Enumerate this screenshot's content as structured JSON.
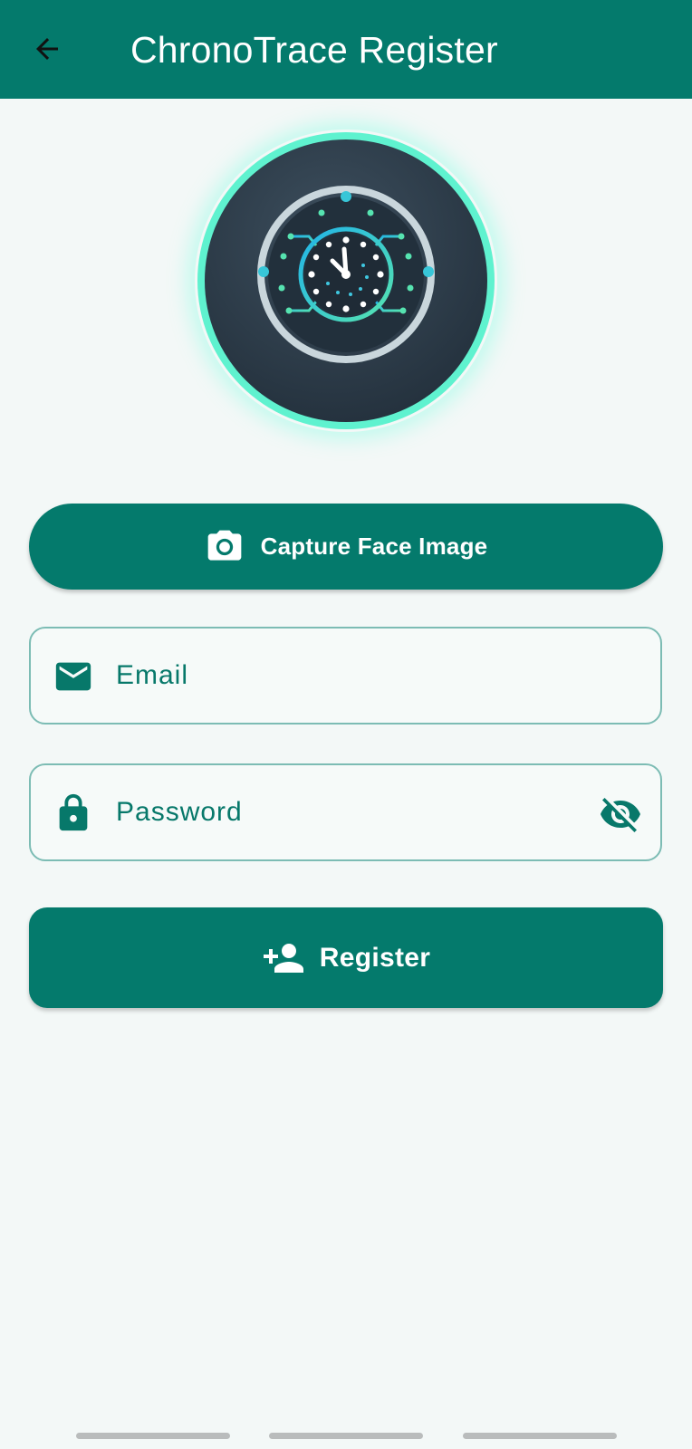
{
  "appbar": {
    "title": "ChronoTrace Register",
    "back_icon": "arrow-back-icon",
    "background": "#047a6c"
  },
  "logo": {
    "icon": "circuit-clock-logo",
    "ring_color": "#5ff2cf"
  },
  "capture_button": {
    "label": "Capture Face Image",
    "icon": "camera-icon"
  },
  "email_field": {
    "placeholder": "Email",
    "value": "",
    "icon": "mail-icon"
  },
  "password_field": {
    "placeholder": "Password",
    "value": "",
    "icon": "lock-icon",
    "toggle_icon": "visibility-off-icon"
  },
  "register_button": {
    "label": "Register",
    "icon": "person-add-icon"
  },
  "colors": {
    "primary": "#047a6c",
    "background": "#f3f8f7",
    "field_border": "#7cbcb4"
  }
}
